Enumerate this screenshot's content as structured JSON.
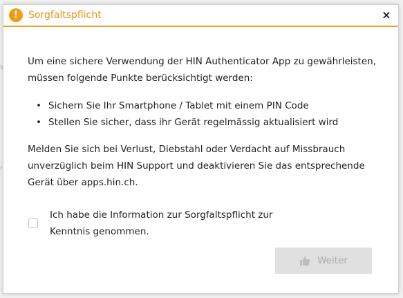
{
  "dialog": {
    "title": "Sorgfaltspflicht",
    "close_label": "×",
    "intro": "Um eine sichere Verwendung der HIN Authenticator App zu gewährleisten, müssen folgende Punkte berücksichtigt werden:",
    "bullets": [
      "Sichern Sie Ihr Smartphone / Tablet mit einem PIN Code",
      "Stellen Sie sicher, dass ihr Gerät regelmässig aktualisiert wird"
    ],
    "report_text": "Melden Sie sich bei Verlust, Diebstahl oder Verdacht auf Missbrauch unverzüglich beim HIN Support und deaktivieren Sie das entsprechende Gerät über apps.hin.ch.",
    "checkbox_label": "Ich habe die Information zur Sorgfaltspflicht zur Kenntnis genommen.",
    "checkbox_checked": false,
    "continue_label": "Weiter",
    "continue_enabled": false
  },
  "icons": {
    "warning": "warning-icon",
    "close": "close-icon",
    "thumbs_up": "thumbs-up-icon"
  },
  "colors": {
    "accent": "#f0a030",
    "warning_icon": "#f39c12",
    "title_text": "#e8951a",
    "disabled_button_bg": "#e0e0e0",
    "disabled_button_text": "#a9a9a9"
  }
}
